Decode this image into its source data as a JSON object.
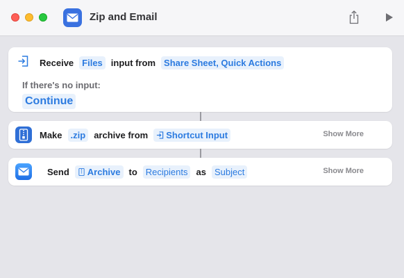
{
  "window": {
    "title": "Zip and Email"
  },
  "toolbar": {
    "share_icon": "share-icon",
    "run_icon": "play-icon"
  },
  "actions": [
    {
      "verb": "Receive",
      "type_token": "Files",
      "middle": "input from",
      "source_token": "Share Sheet, Quick Actions",
      "no_input_label": "If there's no input:",
      "no_input_value": "Continue",
      "icon": "receive-input-icon"
    },
    {
      "verb": "Make",
      "format_token": ".zip",
      "middle": "archive from",
      "input_token": "Shortcut Input",
      "show_more": "Show More",
      "icon": "zip-archive-icon"
    },
    {
      "verb": "Send",
      "archive_token": "Archive",
      "to_word": "to",
      "recipients_token": "Recipients",
      "as_word": "as",
      "subject_token": "Subject",
      "show_more": "Show More",
      "icon": "mail-icon"
    }
  ],
  "colors": {
    "accent": "#2c7be0",
    "token_bg": "#e8f1fc",
    "app_icon": "#3a71e0"
  }
}
